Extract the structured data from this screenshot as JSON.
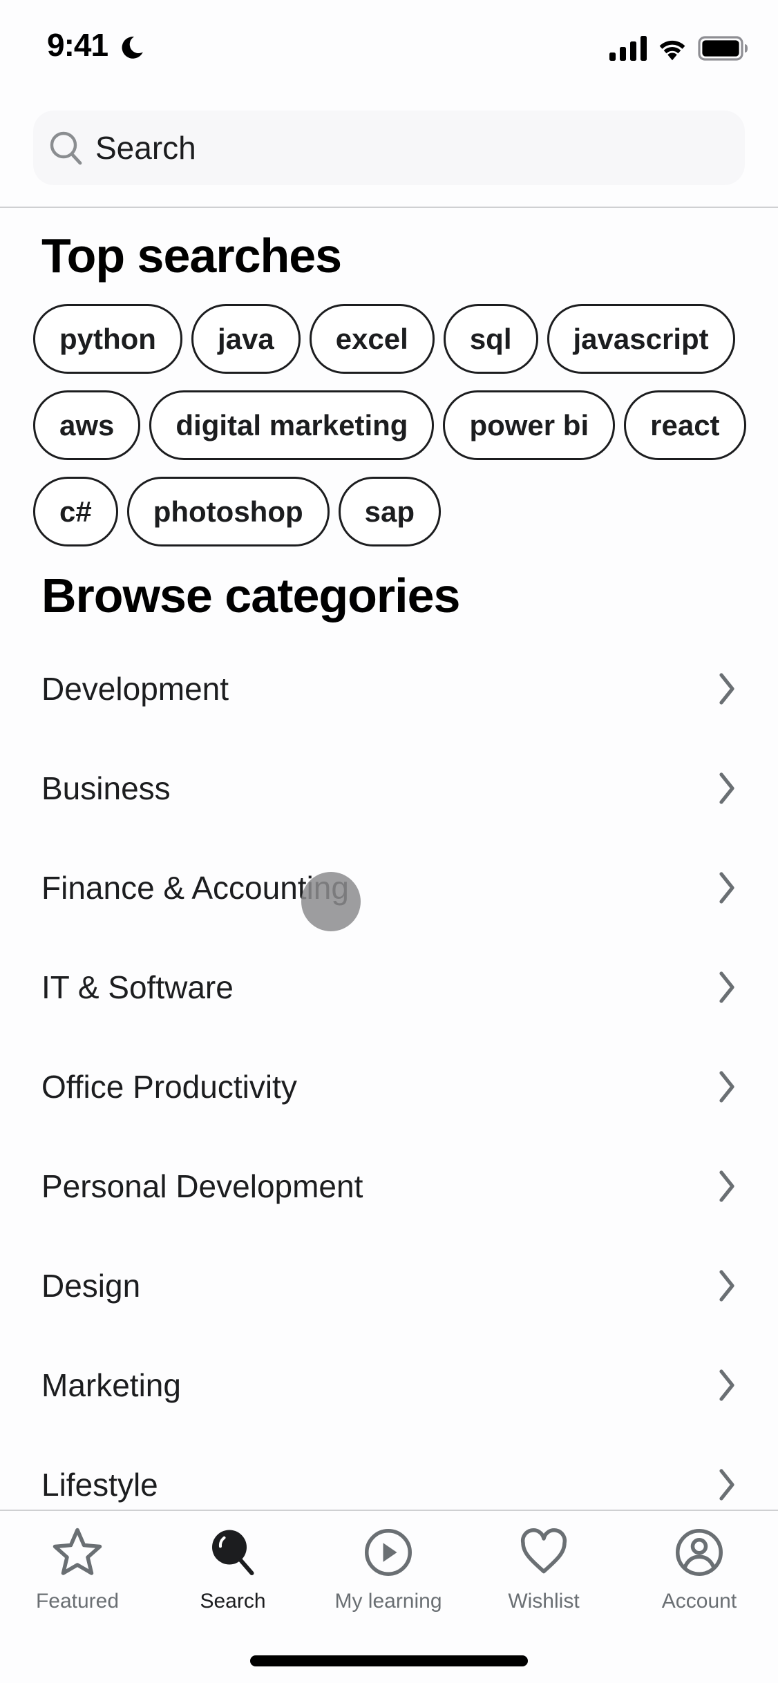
{
  "status_bar": {
    "time": "9:41",
    "icons": [
      "moon-icon",
      "cellular-signal-icon",
      "wifi-icon",
      "battery-icon"
    ]
  },
  "search": {
    "placeholder": "Search",
    "value": "",
    "icon": "search-icon"
  },
  "top_searches": {
    "title": "Top searches",
    "chips": [
      "python",
      "java",
      "excel",
      "sql",
      "javascript",
      "aws",
      "digital marketing",
      "power bi",
      "react",
      "c#",
      "photoshop",
      "sap"
    ]
  },
  "browse_categories": {
    "title": "Browse categories",
    "items": [
      {
        "label": "Development"
      },
      {
        "label": "Business"
      },
      {
        "label": "Finance & Accounting"
      },
      {
        "label": "IT & Software"
      },
      {
        "label": "Office Productivity"
      },
      {
        "label": "Personal Development"
      },
      {
        "label": "Design"
      },
      {
        "label": "Marketing"
      },
      {
        "label": "Lifestyle"
      }
    ],
    "chevron_icon": "chevron-right-icon"
  },
  "tab_bar": {
    "active": "Search",
    "tabs": [
      {
        "label": "Featured",
        "icon": "star-icon"
      },
      {
        "label": "Search",
        "icon": "search-icon"
      },
      {
        "label": "My learning",
        "icon": "play-circle-icon"
      },
      {
        "label": "Wishlist",
        "icon": "heart-icon"
      },
      {
        "label": "Account",
        "icon": "account-icon"
      }
    ]
  },
  "colors": {
    "text_primary": "#1c1d1f",
    "text_secondary": "#6a6f73",
    "chevron": "#6a6f73",
    "search_bg": "#f7f7f9",
    "divider": "#cfd0d2"
  }
}
